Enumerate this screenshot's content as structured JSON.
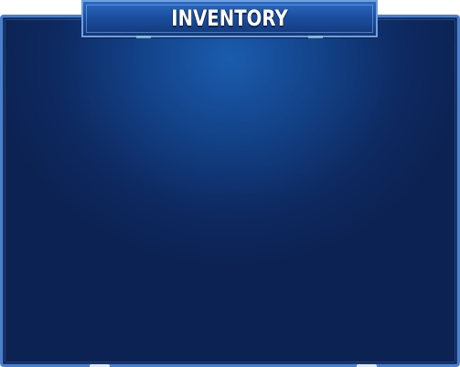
{
  "window": {
    "title": "INVENTORY"
  },
  "inventory": {
    "items": []
  },
  "theme": {
    "panel_color": "#0e2a62",
    "glow_color": "#1b5cae",
    "border_color": "#4c7fc9",
    "title_color": "#ffffff"
  }
}
